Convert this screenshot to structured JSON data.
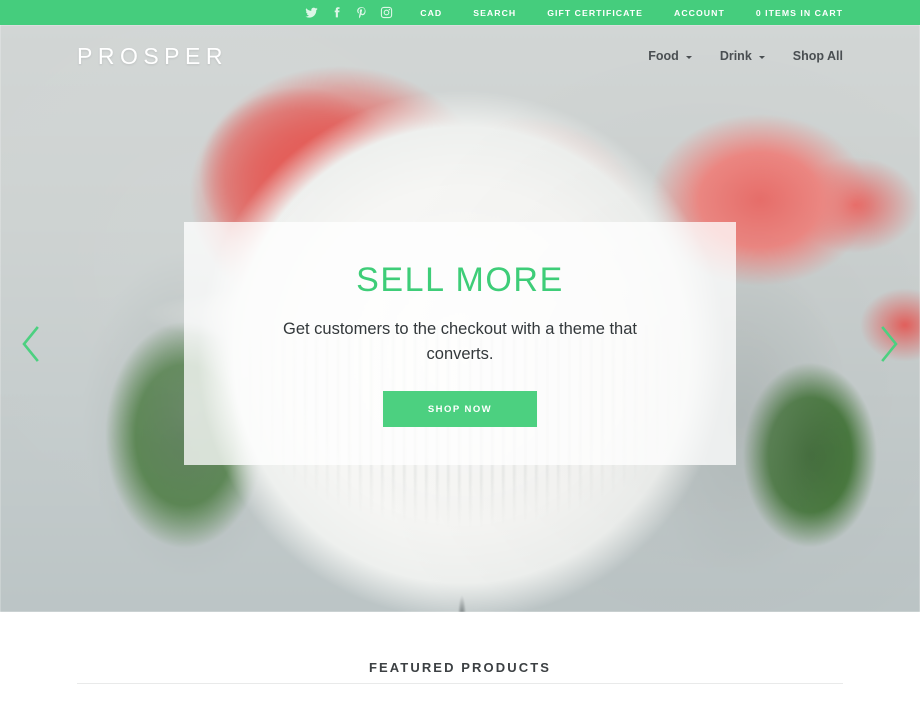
{
  "topbar": {
    "background_color": "#45cd7d",
    "social": [
      {
        "name": "twitter-icon",
        "label": "Twitter"
      },
      {
        "name": "facebook-icon",
        "label": "Facebook"
      },
      {
        "name": "pinterest-icon",
        "label": "Pinterest"
      },
      {
        "name": "instagram-icon",
        "label": "Instagram"
      }
    ],
    "links": [
      {
        "label": "CAD"
      },
      {
        "label": "SEARCH"
      },
      {
        "label": "GIFT CERTIFICATE"
      },
      {
        "label": "ACCOUNT"
      },
      {
        "label": "0 ITEMS IN CART"
      }
    ]
  },
  "header": {
    "logo": "PROSPER",
    "nav": [
      {
        "label": "Food",
        "has_dropdown": true
      },
      {
        "label": "Drink",
        "has_dropdown": true
      },
      {
        "label": "Shop All",
        "has_dropdown": false
      }
    ]
  },
  "hero": {
    "prev_icon": "chevron-left-icon",
    "next_icon": "chevron-right-icon",
    "arrow_color": "#4cd080",
    "slide": {
      "title": "SELL MORE",
      "title_color": "#3ecd78",
      "subtitle": "Get customers to the checkout with a theme that converts.",
      "cta_label": "SHOP NOW",
      "cta_color": "#4cd080"
    }
  },
  "featured": {
    "title": "FEATURED PRODUCTS"
  }
}
